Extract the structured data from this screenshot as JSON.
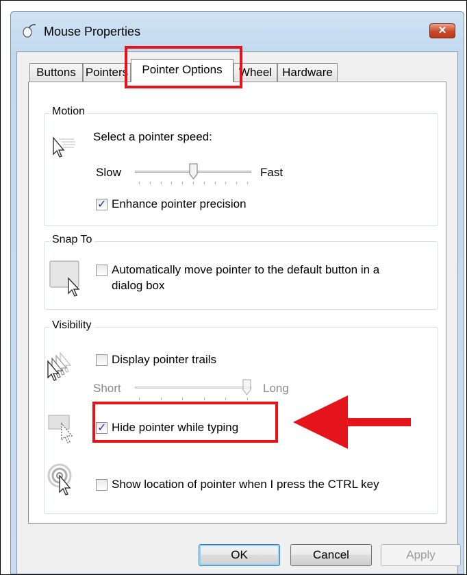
{
  "window": {
    "title": "Mouse Properties",
    "close_glyph": "✕"
  },
  "tabs": [
    {
      "label": "Buttons"
    },
    {
      "label": "Pointers"
    },
    {
      "label": "Pointer Options",
      "active": true
    },
    {
      "label": "Wheel"
    },
    {
      "label": "Hardware"
    }
  ],
  "motion": {
    "group_label": "Motion",
    "speed_label": "Select a pointer speed:",
    "slow_label": "Slow",
    "fast_label": "Fast",
    "speed_value": 0.5,
    "enhance_label": "Enhance pointer precision",
    "enhance_checked": true
  },
  "snap": {
    "group_label": "Snap To",
    "auto_label_line1": "Automatically move pointer to the default button in a",
    "auto_label_line2": "dialog box",
    "auto_checked": false
  },
  "visibility": {
    "group_label": "Visibility",
    "trails_label": "Display pointer trails",
    "trails_checked": false,
    "short_label": "Short",
    "long_label": "Long",
    "trails_value": 1.0,
    "hide_label": "Hide pointer while typing",
    "hide_checked": true,
    "ctrl_label": "Show location of pointer when I press the CTRL key",
    "ctrl_checked": false
  },
  "buttons": {
    "ok": "OK",
    "cancel": "Cancel",
    "apply": "Apply"
  },
  "annotation": {
    "highlight_color": "#e5141b"
  },
  "icons": {
    "title": "mouse-icon",
    "motion": "pointer-speed-icon",
    "snap": "snap-to-icon",
    "trails": "pointer-trails-icon",
    "hide": "hide-pointer-icon",
    "ctrl": "pointer-location-icon"
  }
}
